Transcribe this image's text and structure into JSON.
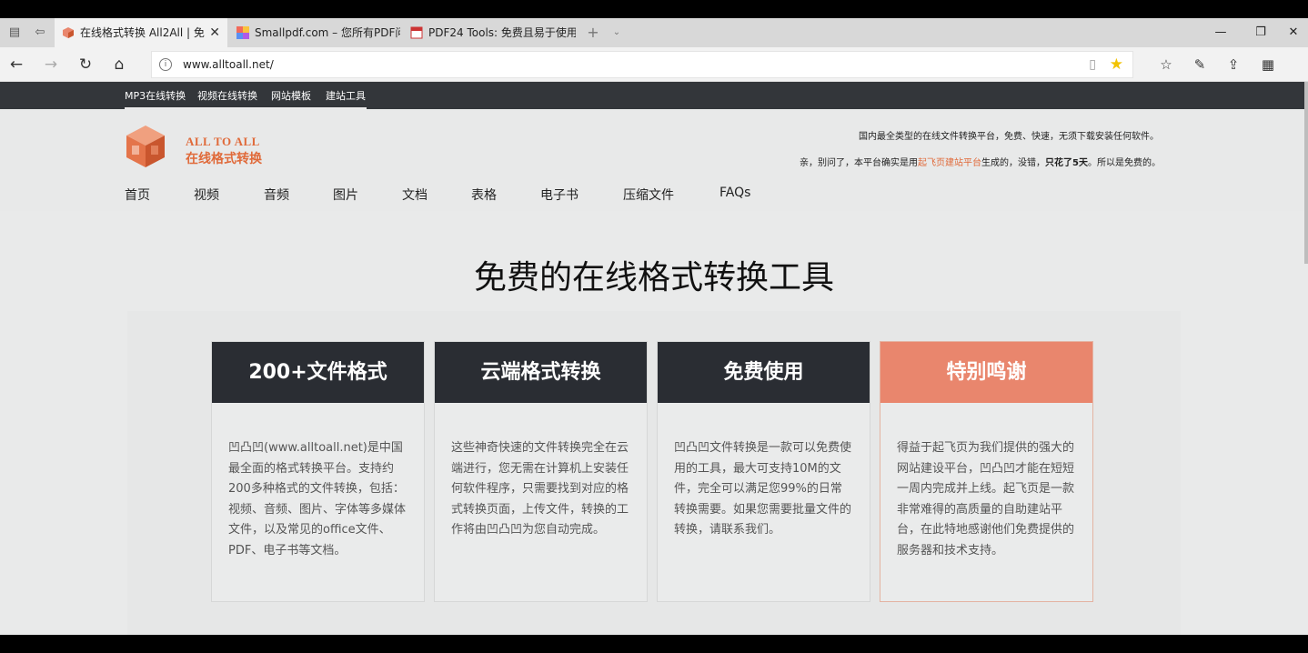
{
  "browser": {
    "tabs": [
      {
        "title": "在线格式转换 All2All | 免",
        "close": "✕"
      },
      {
        "title": "Smallpdf.com – 您所有PDF问"
      },
      {
        "title": "PDF24 Tools: 免费且易于使用"
      }
    ],
    "new_tab": "+",
    "tab_list": "⌄",
    "window_controls": {
      "minimize": "—",
      "restore": "❐",
      "close": "✕"
    },
    "nav": {
      "back": "←",
      "forward": "→",
      "refresh": "↻",
      "home": "⌂"
    },
    "url": "www.alltoall.net/",
    "info_icon": "i",
    "reading_icon": "▯",
    "favorite_icon": "★",
    "toolbar": {
      "favorites": "☆",
      "notes": "✎",
      "share": "⇪",
      "hub": "▦"
    },
    "colors": {
      "favorite_star": "#f2c300"
    }
  },
  "site_top_nav": [
    "MP3在线转换",
    "视频在线转换",
    "网站模板",
    "建站工具"
  ],
  "header": {
    "logo_en": "ALL TO ALL",
    "logo_cn": "在线格式转换",
    "tagline": "国内最全类型的在线文件转换平台，免费、快速，无须下载安装任何软件。",
    "note_prefix": "亲，别问了，本平台确实是用",
    "note_link": "起飞页建站平台",
    "note_mid": "生成的，没错，",
    "note_bold": "只花了5天",
    "note_suffix": "。所以是免费的。",
    "brand_color": "#e06a3a"
  },
  "main_nav": [
    "首页",
    "视频",
    "音频",
    "图片",
    "文档",
    "表格",
    "电子书",
    "压缩文件",
    "FAQs"
  ],
  "hero": {
    "title": "免费的在线格式转换工具"
  },
  "cards": [
    {
      "title": "200+文件格式",
      "body": "凹凸凹(www.alltoall.net)是中国最全面的格式转换平台。支持约200多种格式的文件转换，包括：视频、音频、图片、字体等多媒体文件，以及常见的office文件、PDF、电子书等文档。"
    },
    {
      "title": "云端格式转换",
      "body": "这些神奇快速的文件转换完全在云端进行，您无需在计算机上安装任何软件程序，只需要找到对应的格式转换页面，上传文件，转换的工作将由凹凸凹为您自动完成。"
    },
    {
      "title": "免费使用",
      "body": "凹凸凹文件转换是一款可以免费使用的工具，最大可支持10M的文件，完全可以满足您99%的日常转换需要。如果您需要批量文件的转换，请联系我们。"
    },
    {
      "title": "特别鸣谢",
      "body": "得益于起飞页为我们提供的强大的网站建设平台，凹凸凹才能在短短一周内完成并上线。起飞页是一款非常难得的高质量的自助建站平台，在此特地感谢他们免费提供的服务器和技术支持。"
    }
  ],
  "card_colors": {
    "dark": "#2a2d33",
    "accent": "#e9866d"
  }
}
